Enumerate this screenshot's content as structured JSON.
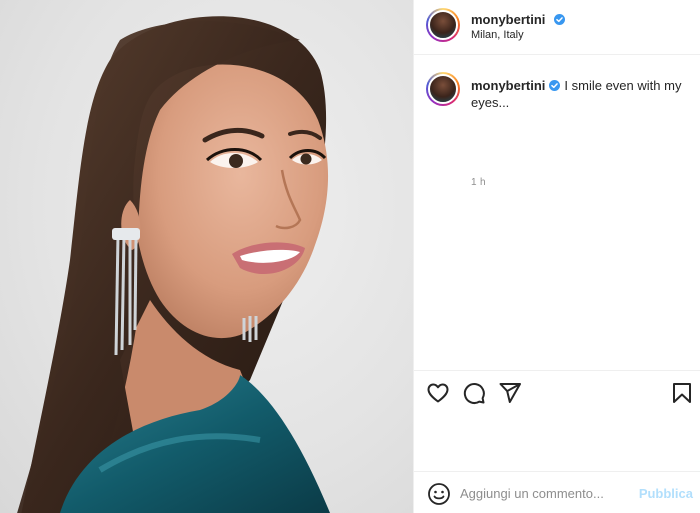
{
  "post": {
    "image_alt": "Portrait of a smiling woman in a teal velvet top wearing long crystal earrings",
    "image_icon": "photo-portrait"
  },
  "header": {
    "username": "monybertini",
    "verified_icon": "verified-badge-icon",
    "location": "Milan, Italy"
  },
  "caption": {
    "username": "monybertini",
    "text": "I smile even with my eyes...",
    "time": "1 h"
  },
  "actions": {
    "like_icon": "heart-icon",
    "comment_icon": "comment-icon",
    "share_icon": "paper-plane-icon",
    "save_icon": "bookmark-icon"
  },
  "comment_box": {
    "emoji_icon": "emoji-icon",
    "placeholder": "Aggiungi un commento...",
    "publish_label": "Pubblica"
  },
  "colors": {
    "verified": "#3897f0",
    "publish_disabled": "#b2dffc",
    "secondary_text": "#8e8e8e",
    "divider": "#efefef"
  }
}
